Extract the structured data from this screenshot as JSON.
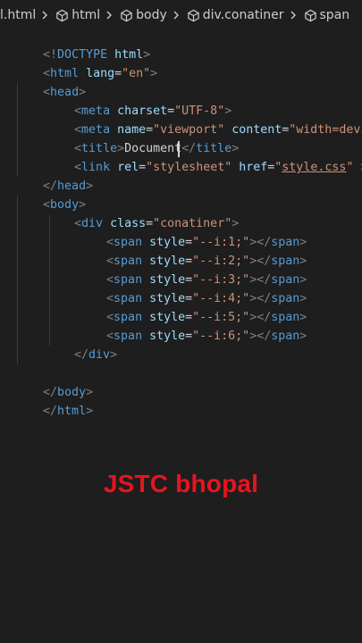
{
  "breadcrumb": {
    "file": "l.html",
    "items": [
      "html",
      "body",
      "div.conatiner",
      "span"
    ]
  },
  "code": {
    "doctype": {
      "open": "<!",
      "name": "DOCTYPE",
      "rest": " html",
      "close": ">"
    },
    "html_open": {
      "open": "<",
      "tag": "html",
      "attr": "lang",
      "eq": "=",
      "val": "\"en\"",
      "close": ">"
    },
    "head_open": {
      "open": "<",
      "tag": "head",
      "close": ">"
    },
    "meta_charset": {
      "open": "<",
      "tag": "meta",
      "attr": "charset",
      "eq": "=",
      "val": "\"UTF-8\"",
      "close": ">"
    },
    "meta_viewport": {
      "open": "<",
      "tag": "meta",
      "attr1": "name",
      "eq1": "=",
      "val1": "\"viewport\"",
      "attr2": "content",
      "eq2": "=",
      "val2": "\"width=devi"
    },
    "title": {
      "open": "<",
      "tag": "title",
      "close": ">",
      "text": "Document",
      "end_open": "</",
      "end_tag": "title",
      "end_close": ">"
    },
    "link": {
      "open": "<",
      "tag": "link",
      "attr1": "rel",
      "eq1": "=",
      "val1a": "\"styles",
      "val1b": "heet\"",
      "attr2": "href",
      "eq2": "=",
      "q_open": "\"",
      "href": "style.css",
      "q_close": "\"",
      "close": " >"
    },
    "head_close": {
      "open": "</",
      "tag": "head",
      "close": ">"
    },
    "body_open": {
      "open": "<",
      "tag": "body",
      "close": ">"
    },
    "div_open": {
      "open": "<",
      "tag": "div",
      "attr": "class",
      "eq": "=",
      "val": "\"conatiner\"",
      "close": ">"
    },
    "span_lines": [
      {
        "open": "<",
        "tag": "span",
        "attr": "style",
        "eq": "=",
        "val": "\"--i:1;\"",
        "mid": "></",
        "end_tag": "span",
        "close": ">"
      },
      {
        "open": "<",
        "tag": "span",
        "attr": "style",
        "eq": "=",
        "val": "\"--i:2;\"",
        "mid": "></",
        "end_tag": "span",
        "close": ">"
      },
      {
        "open": "<",
        "tag": "span",
        "attr": "style",
        "eq": "=",
        "val": "\"--i:3;\"",
        "mid": "></",
        "end_tag": "span",
        "close": ">"
      },
      {
        "open": "<",
        "tag": "span",
        "attr": "style",
        "eq": "=",
        "val": "\"--i:4;\"",
        "mid": "></",
        "end_tag": "span",
        "close": ">"
      },
      {
        "open": "<",
        "tag": "span",
        "attr": "style",
        "eq": "=",
        "val": "\"--i:5;\"",
        "mid": "></",
        "end_tag": "span",
        "close": ">"
      },
      {
        "open": "<",
        "tag": "span",
        "attr": "style",
        "eq": "=",
        "val": "\"--i:6;\"",
        "mid": "></",
        "end_tag": "span",
        "close": ">"
      }
    ],
    "div_close": {
      "open": "</",
      "tag": "div",
      "close": ">"
    },
    "body_close": {
      "open": "</",
      "tag": "body",
      "close": ">"
    },
    "html_close": {
      "open": "</",
      "tag": "html",
      "close": ">"
    }
  },
  "watermark": "JSTC bhopal",
  "colors": {
    "background": "#1e1e1e",
    "tag_name": "#569cd6",
    "punctuation": "#808080",
    "attribute": "#9cdcfe",
    "string": "#ce9178",
    "watermark": "#e8141e"
  }
}
